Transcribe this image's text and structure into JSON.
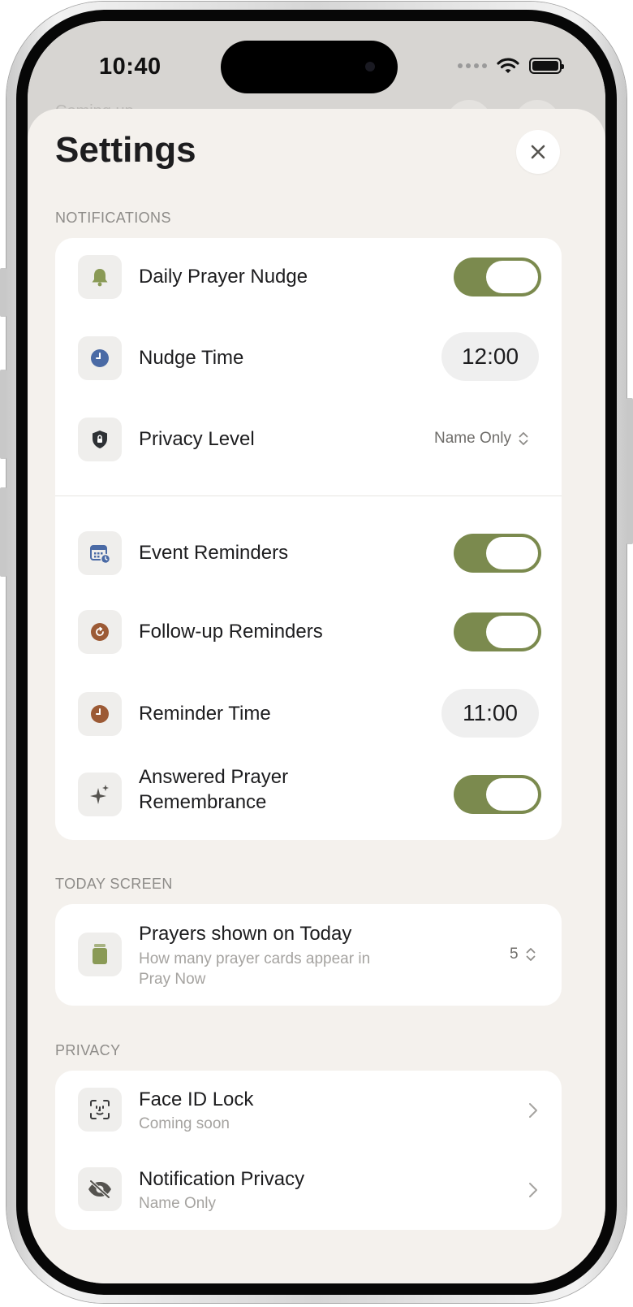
{
  "status_bar": {
    "time": "10:40"
  },
  "backdrop": {
    "peek_text": "Coming up..."
  },
  "sheet": {
    "title": "Settings"
  },
  "colors": {
    "toggle_on": "#7b8a4e",
    "sheet_bg": "#f4f1ed",
    "card_bg": "#ffffff"
  },
  "notifications": {
    "header": "NOTIFICATIONS",
    "daily_prayer_nudge": {
      "label": "Daily Prayer Nudge",
      "on": true,
      "icon": "bell-icon"
    },
    "nudge_time": {
      "label": "Nudge Time",
      "value": "12:00",
      "icon": "clock-icon"
    },
    "privacy_level": {
      "label": "Privacy Level",
      "value": "Name Only",
      "icon": "shield-icon"
    },
    "event_reminders": {
      "label": "Event Reminders",
      "on": true,
      "icon": "calendar-icon"
    },
    "follow_up_reminders": {
      "label": "Follow-up Reminders",
      "on": true,
      "icon": "refresh-icon"
    },
    "reminder_time": {
      "label": "Reminder Time",
      "value": "11:00",
      "icon": "clock-icon"
    },
    "answered_prayer_remembrance": {
      "label_line1": "Answered Prayer",
      "label_line2": "Remembrance",
      "on": true,
      "icon": "sparkles-icon"
    }
  },
  "today_screen": {
    "header": "TODAY SCREEN",
    "prayers_shown": {
      "label": "Prayers shown on Today",
      "sub_line1": "How many prayer cards appear in",
      "sub_line2": "Pray Now",
      "value": "5",
      "icon": "stack-icon"
    }
  },
  "privacy": {
    "header": "PRIVACY",
    "face_id_lock": {
      "label": "Face ID Lock",
      "sub": "Coming soon",
      "icon": "faceid-icon"
    },
    "notification_privacy": {
      "label": "Notification Privacy",
      "sub": "Name Only",
      "icon": "eye-slash-icon"
    }
  }
}
